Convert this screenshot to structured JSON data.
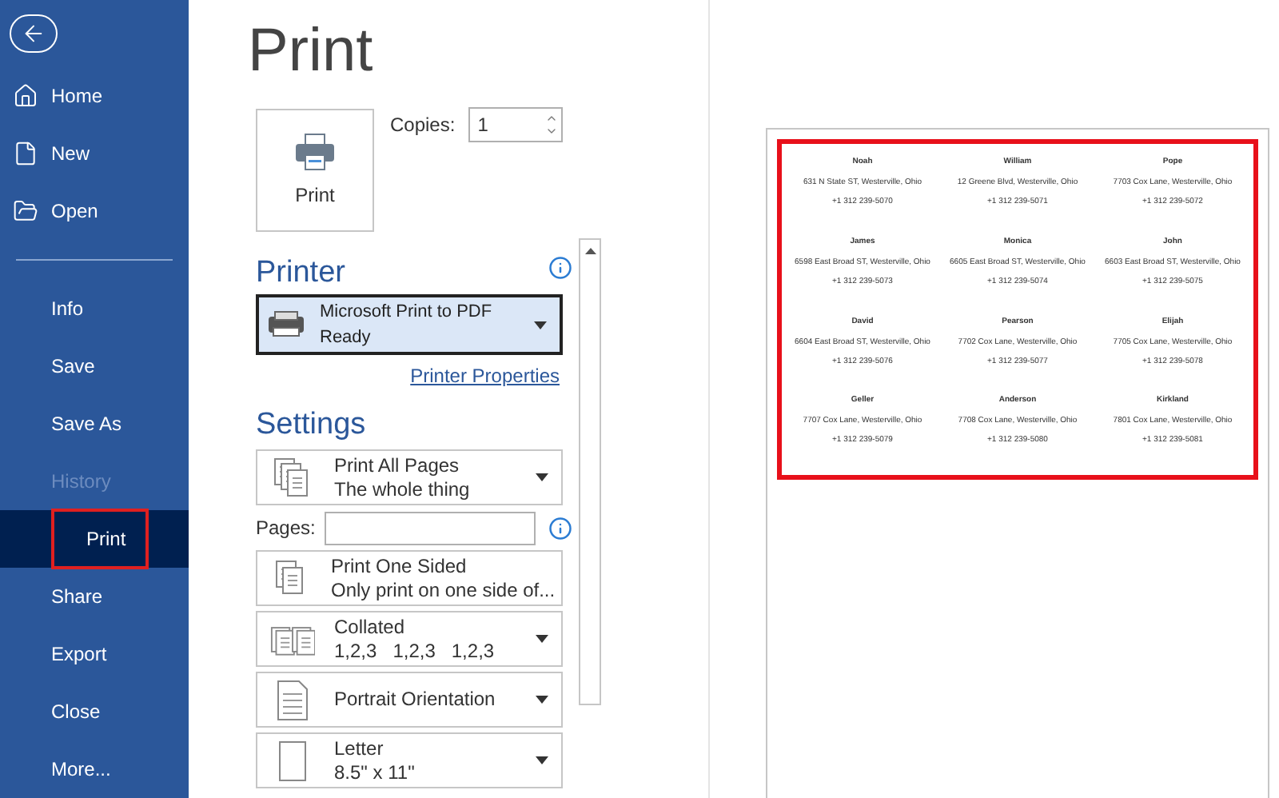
{
  "sidebar": {
    "items": [
      {
        "label": "Home",
        "kind": "home",
        "disabled": false,
        "selected": false
      },
      {
        "label": "New",
        "kind": "new",
        "disabled": false,
        "selected": false
      },
      {
        "label": "Open",
        "kind": "open",
        "disabled": false,
        "selected": false
      },
      {
        "label": "Info",
        "kind": "plain",
        "disabled": false,
        "selected": false
      },
      {
        "label": "Save",
        "kind": "plain",
        "disabled": false,
        "selected": false
      },
      {
        "label": "Save As",
        "kind": "plain",
        "disabled": false,
        "selected": false
      },
      {
        "label": "History",
        "kind": "plain",
        "disabled": true,
        "selected": false
      },
      {
        "label": "Print",
        "kind": "plain",
        "disabled": false,
        "selected": true
      },
      {
        "label": "Share",
        "kind": "plain",
        "disabled": false,
        "selected": false
      },
      {
        "label": "Export",
        "kind": "plain",
        "disabled": false,
        "selected": false
      },
      {
        "label": "Close",
        "kind": "plain",
        "disabled": false,
        "selected": false
      },
      {
        "label": "More...",
        "kind": "plain",
        "disabled": false,
        "selected": false
      }
    ]
  },
  "title": "Print",
  "print_button": {
    "label": "Print"
  },
  "copies": {
    "label": "Copies:",
    "value": "1"
  },
  "printer": {
    "heading": "Printer",
    "name": "Microsoft Print to PDF",
    "status": "Ready",
    "properties_link": "Printer Properties"
  },
  "settings": {
    "heading": "Settings",
    "pages_label": "Pages:",
    "options": [
      {
        "kind": "pages",
        "title": "Print All Pages",
        "subtitle": "The whole thing"
      },
      {
        "kind": "sides",
        "title": "Print One Sided",
        "subtitle": "Only print on one side of..."
      },
      {
        "kind": "collate",
        "title": "Collated",
        "subtitle": "1,2,3   1,2,3   1,2,3"
      },
      {
        "kind": "orientation",
        "title": "Portrait Orientation"
      },
      {
        "kind": "paper",
        "title": "Letter",
        "subtitle": "8.5\" x 11\""
      }
    ]
  },
  "preview": {
    "labels": [
      {
        "name": "Noah",
        "address": "631 N State ST, Westerville, Ohio",
        "phone": "+1 312 239-5070"
      },
      {
        "name": "William",
        "address": "12 Greene Blvd, Westerville, Ohio",
        "phone": "+1 312 239-5071"
      },
      {
        "name": "Pope",
        "address": "7703 Cox Lane, Westerville, Ohio",
        "phone": "+1 312 239-5072"
      },
      {
        "name": "James",
        "address": "6598 East Broad ST, Westerville, Ohio",
        "phone": "+1 312 239-5073"
      },
      {
        "name": "Monica",
        "address": "6605 East Broad ST, Westerville, Ohio",
        "phone": "+1 312 239-5074"
      },
      {
        "name": "John",
        "address": "6603 East Broad ST, Westerville, Ohio",
        "phone": "+1 312 239-5075"
      },
      {
        "name": "David",
        "address": "6604 East Broad ST, Westerville, Ohio",
        "phone": "+1 312 239-5076"
      },
      {
        "name": "Pearson",
        "address": "7702 Cox Lane, Westerville, Ohio",
        "phone": "+1 312 239-5077"
      },
      {
        "name": "Elijah",
        "address": "7705 Cox Lane, Westerville, Ohio",
        "phone": "+1 312 239-5078"
      },
      {
        "name": "Geller",
        "address": "7707 Cox Lane, Westerville, Ohio",
        "phone": "+1 312 239-5079"
      },
      {
        "name": "Anderson",
        "address": "7708 Cox Lane, Westerville, Ohio",
        "phone": "+1 312 239-5080"
      },
      {
        "name": "Kirkland",
        "address": "7801 Cox Lane, Westerville, Ohio",
        "phone": "+1 312 239-5081"
      }
    ]
  }
}
